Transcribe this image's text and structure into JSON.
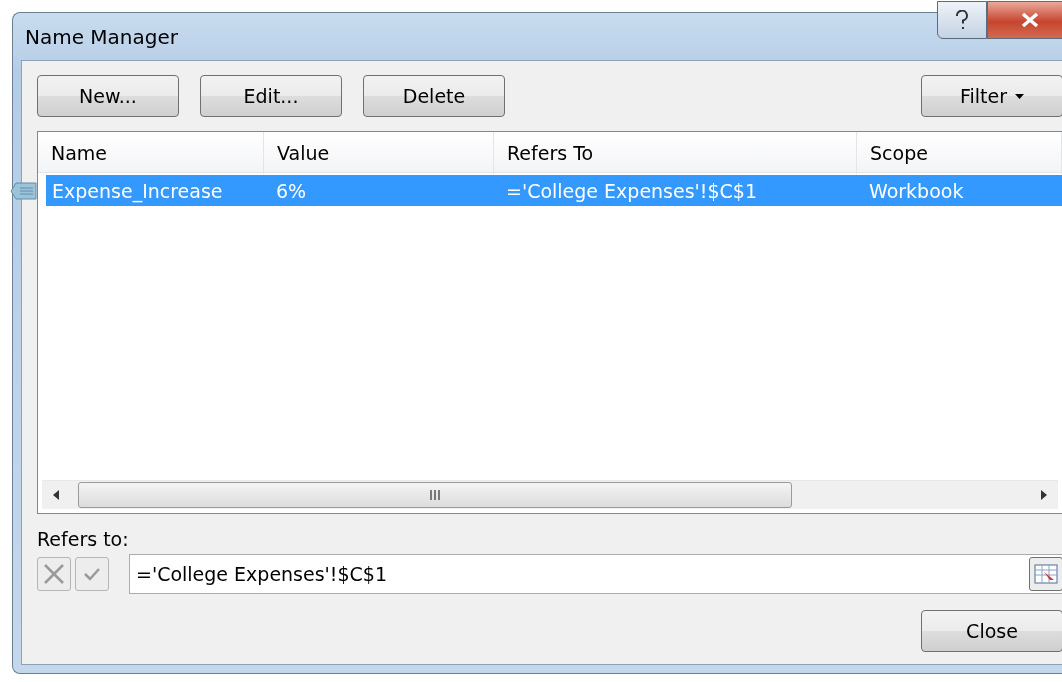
{
  "window": {
    "title": "Name Manager"
  },
  "toolbar": {
    "buttons": [
      "New...",
      "Edit...",
      "Delete"
    ],
    "filter": "Filter"
  },
  "table": {
    "columns": [
      "Name",
      "Value",
      "Refers To",
      "Scope"
    ],
    "rows": [
      {
        "name": "Expense_Increase",
        "value": "6%",
        "refers_to": "='College Expenses'!$C$1",
        "scope": "Workbook",
        "selected": true
      }
    ]
  },
  "refers_to": {
    "label": "Refers to:",
    "value": "='College Expenses'!$C$1",
    "cancel_disabled": true,
    "confirm_disabled": true
  },
  "close_button": "Close"
}
